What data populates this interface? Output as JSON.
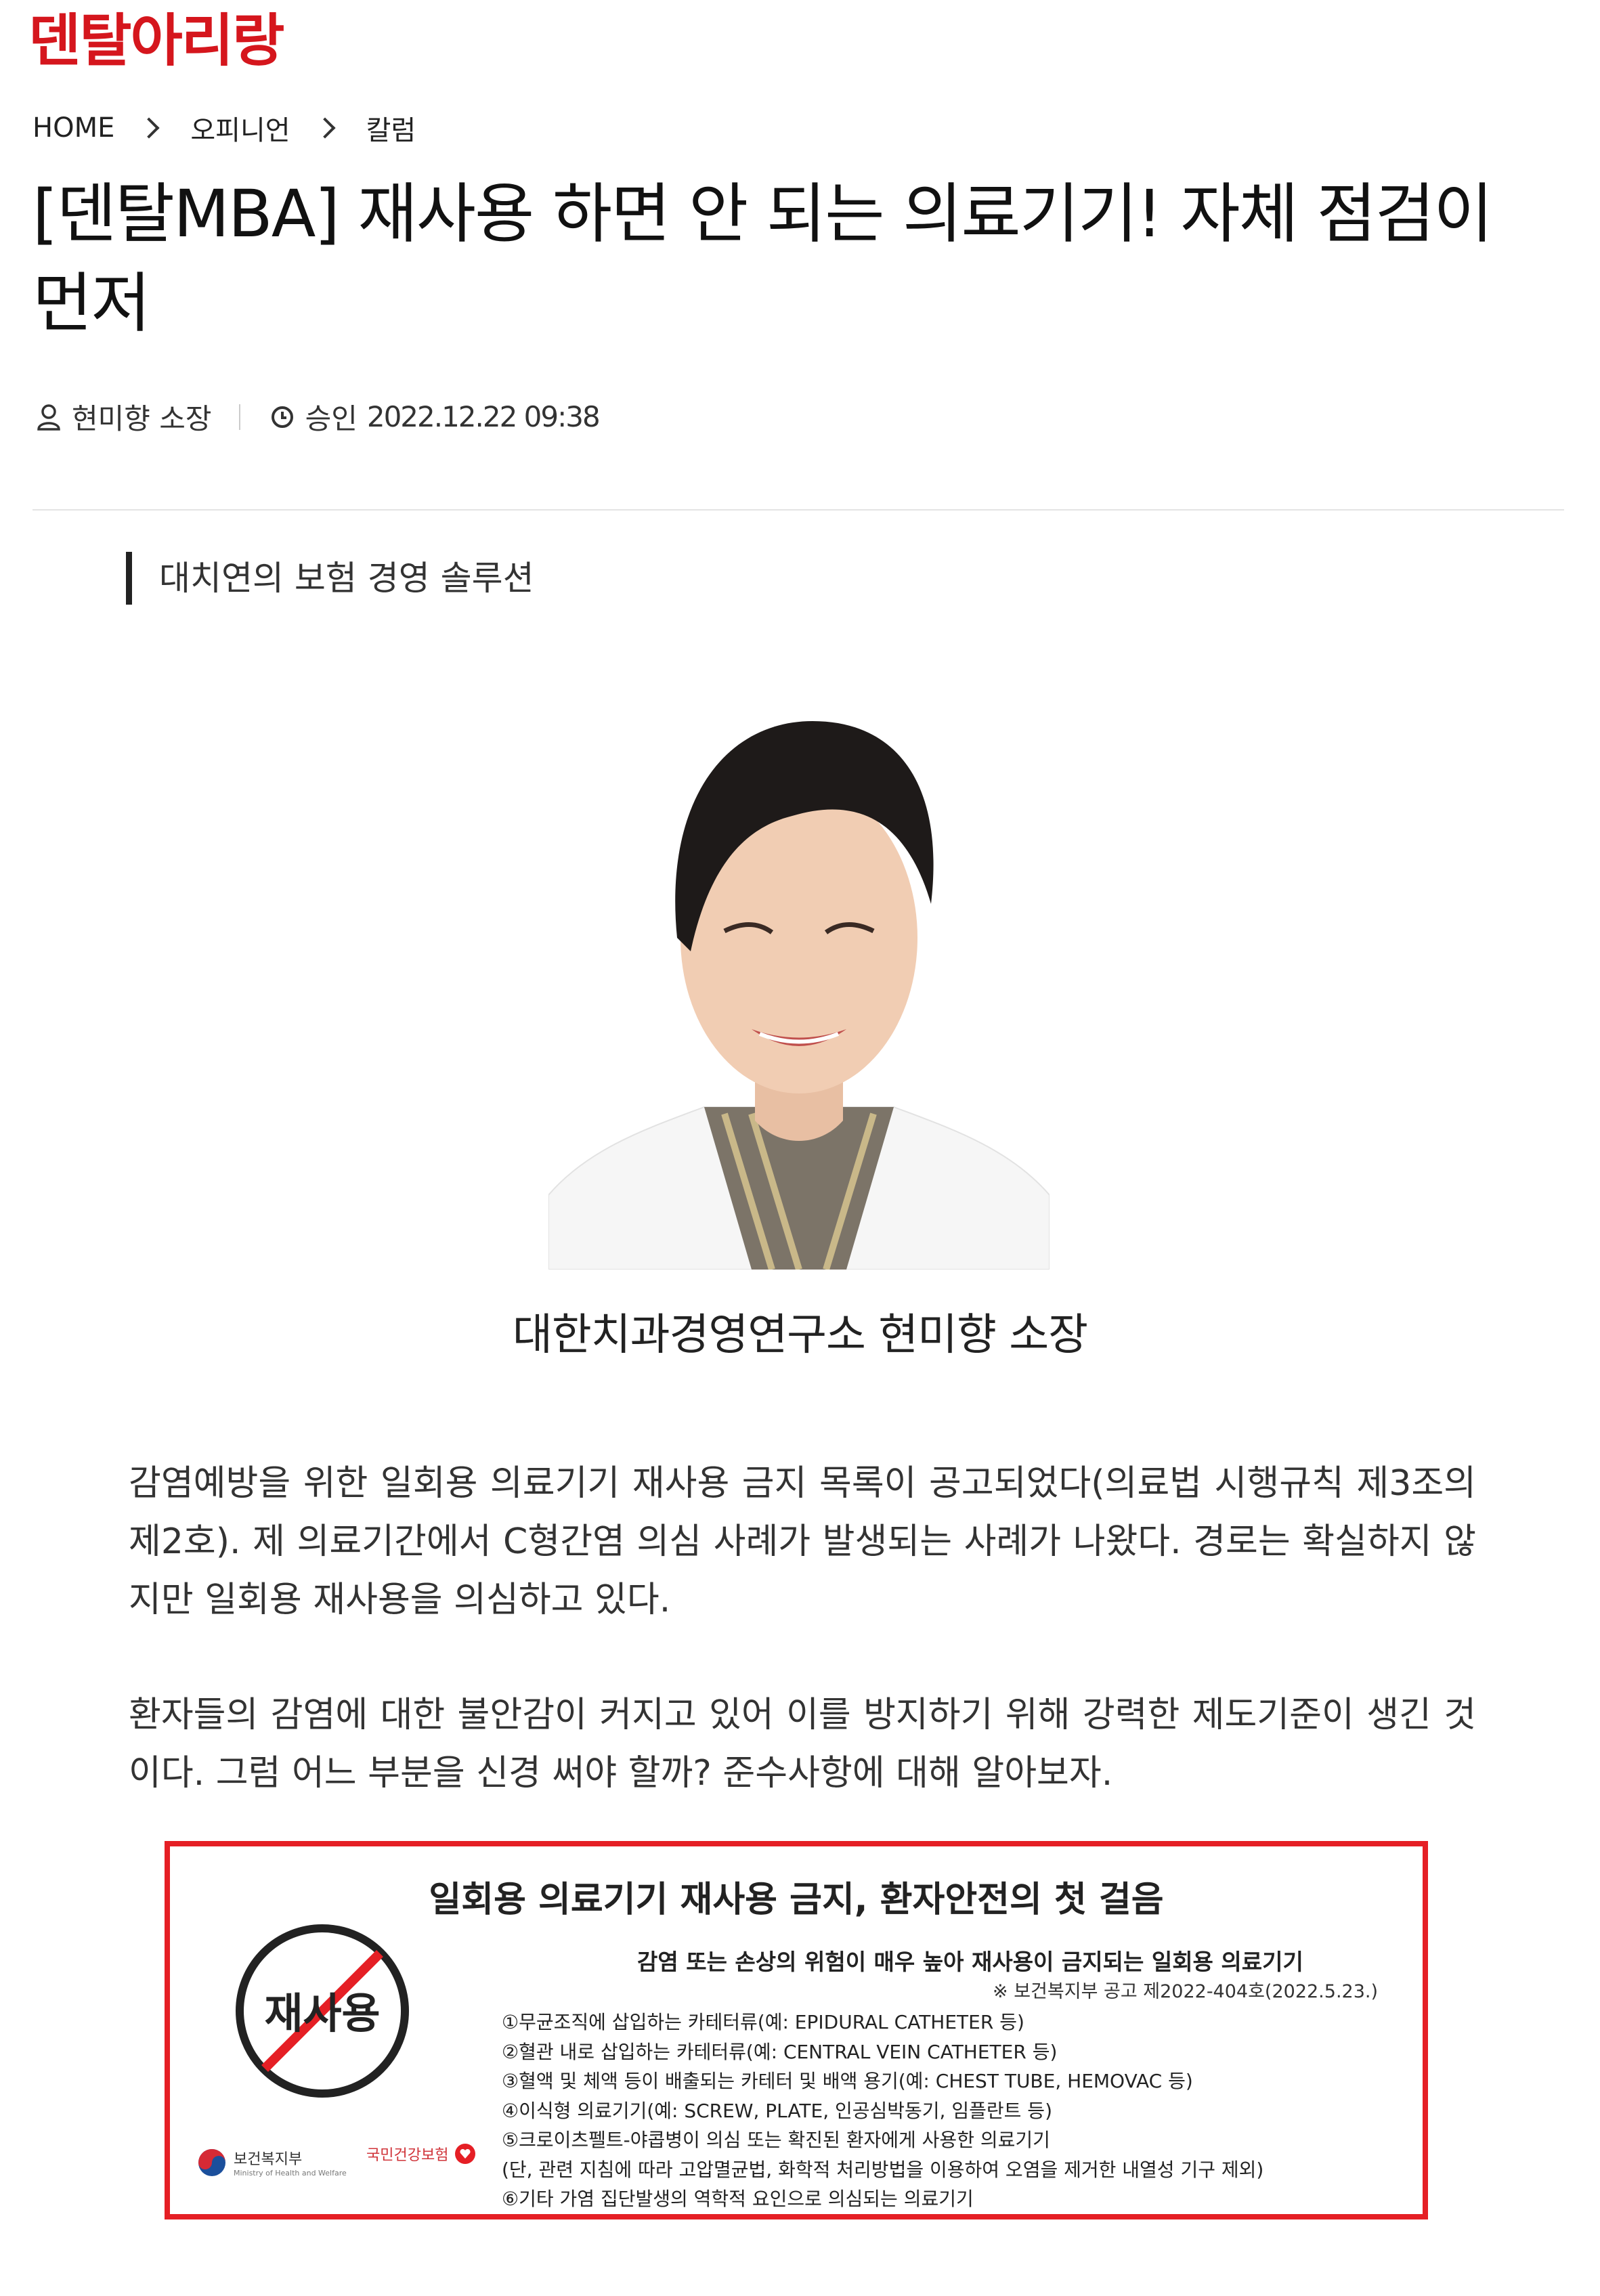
{
  "site": {
    "logo": "덴탈아리랑"
  },
  "breadcrumb": [
    "HOME",
    "오피니언",
    "칼럼"
  ],
  "article": {
    "title": "[덴탈MBA] 재사용 하면 안 되는 의료기기! 자체 점검이 먼저",
    "author": "현미향 소장",
    "approved_label": "승인",
    "date": "2022.12.22 09:38",
    "subheading": "대치연의 보험 경영 솔루션",
    "photo_caption": "대한치과경영연구소 현미향 소장",
    "paragraphs": [
      "감염예방을 위한 일회용 의료기기 재사용 금지 목록이 공고되었다(의료법 시행규칙 제3조의 제2호). 제 의료기간에서 C형간염 의심 사례가 발생되는 사례가 나왔다. 경로는 확실하지 않지만 일회용 재사용을 의심하고 있다.",
      "환자들의 감염에 대한 불안감이 커지고 있어 이를 방지하기 위해 강력한 제도기준이 생긴 것이다. 그럼 어느 부분을 신경 써야 할까?  준수사항에 대해 알아보자."
    ]
  },
  "notice": {
    "title": "일회용 의료기기 재사용 금지, 환자안전의 첫 걸음",
    "subtitle": "감염 또는 손상의 위험이 매우 높아 재사용이 금지되는 일회용 의료기기",
    "source": "※ 보건복지부 공고 제2022-404호(2022.5.23.)",
    "sign_text": "재사용",
    "items": [
      "①무균조직에 삽입하는 카테터류(예: EPIDURAL CATHETER 등)",
      "②혈관 내로 삽입하는 카테터류(예: CENTRAL VEIN CATHETER 등)",
      "③혈액 및 체액 등이 배출되는 카테터 및 배액 용기(예: CHEST TUBE, HEMOVAC 등)",
      "④이식형 의료기기(예: SCREW, PLATE, 인공심박동기, 임플란트 등)",
      "⑤크로이츠펠트-야콥병이 의심 또는 확진된 환자에게 사용한 의료기기",
      "(단, 관련 지침에 따라 고압멸균법, 화학적 처리방법을 이용하여 오염을 제거한 내열성 기구 제외)",
      "⑥기타 가염 집단발생의 역학적 요인으로 의심되는 의료기기"
    ],
    "org1": "보건복지부",
    "org1_en": "Ministry of Health and Welfare",
    "org2": "국민건강보험"
  },
  "colors": {
    "brand": "#d5161d",
    "notice_border": "#e51f25"
  }
}
